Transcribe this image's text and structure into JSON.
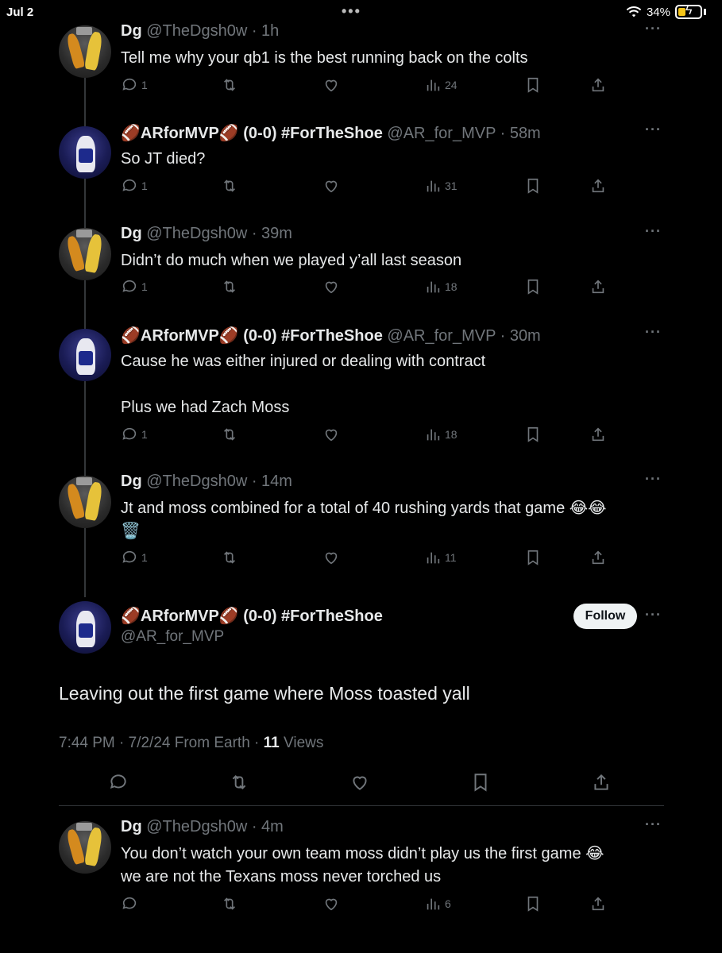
{
  "status": {
    "time": "Jul 2",
    "battery": "34%",
    "battery_level": 0.34
  },
  "tweets": [
    {
      "name": "Dg",
      "meta": "@TheDgsh0w · 1h",
      "text": [
        "Tell me why your qb1 is the best running back on the colts"
      ],
      "replies": "1",
      "views": "24"
    },
    {
      "name": "🏈ARforMVP🏈 (0-0) #ForTheShoe",
      "meta": "@AR_for_MVP · 58m",
      "text": [
        "So JT died?"
      ],
      "replies": "1",
      "views": "31"
    },
    {
      "name": "Dg",
      "meta": "@TheDgsh0w · 39m",
      "text": [
        "Didn’t do much when we played y’all last season"
      ],
      "replies": "1",
      "views": "18"
    },
    {
      "name": "🏈ARforMVP🏈 (0-0) #ForTheShoe",
      "meta": "@AR_for_MVP · 30m",
      "text": [
        "Cause he was either injured or dealing with contract",
        "",
        "Plus we had Zach Moss"
      ],
      "replies": "1",
      "views": "18"
    },
    {
      "name": "Dg",
      "meta": "@TheDgsh0w · 14m",
      "text": [
        "Jt and moss combined for a total of 40 rushing yards that game 😂😂",
        "🗑️"
      ],
      "replies": "1",
      "views": "11"
    }
  ],
  "focus": {
    "name": "🏈ARforMVP🏈 (0-0) #ForTheShoe",
    "handle": "@AR_for_MVP",
    "follow_label": "Follow",
    "text": "Leaving out the first game where Moss toasted yall",
    "timestamp": "7:44 PM · 7/2/24 From Earth · ",
    "views_count": "11",
    "views_label": " Views"
  },
  "reply": {
    "name": "Dg",
    "meta": "@TheDgsh0w · 4m",
    "text": [
      "You don’t watch your own team moss didn’t play us the first game 😂",
      "we are not the Texans moss never torched us"
    ],
    "views": "6"
  },
  "more_label": "···",
  "icons": [
    "reply-icon",
    "retweet-icon",
    "like-icon",
    "views-icon",
    "bookmark-icon",
    "share-icon"
  ]
}
